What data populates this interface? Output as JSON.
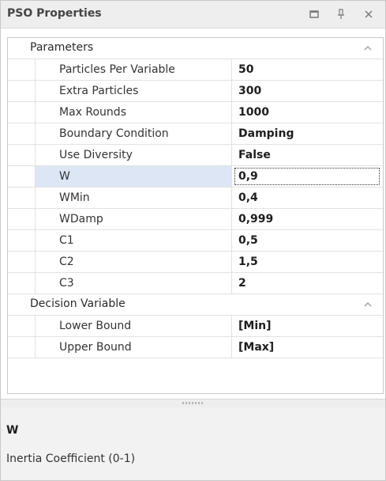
{
  "panel": {
    "title": "PSO Properties",
    "buttons": {
      "maximize_icon": "maximize-icon",
      "pin_icon": "pin-icon",
      "close_icon": "close-icon"
    }
  },
  "categories": [
    {
      "label": "Parameters",
      "expanded": true,
      "properties": [
        {
          "name": "Particles Per Variable",
          "value": "50"
        },
        {
          "name": "Extra Particles",
          "value": "300"
        },
        {
          "name": "Max Rounds",
          "value": "1000"
        },
        {
          "name": "Boundary Condition",
          "value": "Damping"
        },
        {
          "name": "Use Diversity",
          "value": "False"
        },
        {
          "name": "W",
          "value": "0,9"
        },
        {
          "name": "WMin",
          "value": "0,4"
        },
        {
          "name": "WDamp",
          "value": "0,999"
        },
        {
          "name": "C1",
          "value": "0,5"
        },
        {
          "name": "C2",
          "value": "1,5"
        },
        {
          "name": "C3",
          "value": "2"
        }
      ]
    },
    {
      "label": "Decision Variable",
      "expanded": true,
      "properties": [
        {
          "name": "Lower Bound",
          "value": "[Min]"
        },
        {
          "name": "Upper Bound",
          "value": "[Max]"
        }
      ]
    }
  ],
  "selected_property": "W",
  "description": {
    "name": "W",
    "text": "Inertia Coefficient (0-1)"
  },
  "colors": {
    "selected_row": "#dce6f5",
    "titlebar": "#eeeeee",
    "description_bg": "#f2f2f2"
  }
}
